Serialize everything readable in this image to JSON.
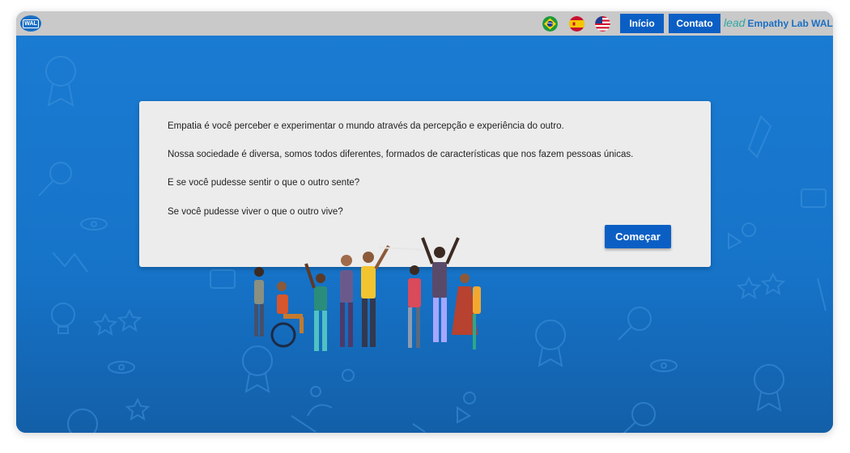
{
  "header": {
    "badge": "WAL",
    "nav": {
      "inicio": "Início",
      "contato": "Contato"
    },
    "brand": {
      "logo": "lead",
      "name": "Empathy Lab WAL"
    },
    "languages": [
      "flag-brazil",
      "flag-spain",
      "flag-usa"
    ]
  },
  "intro": {
    "line1": "Empatia é você perceber e experimentar o mundo através da percepção e experiência do outro.",
    "line2": "Nossa sociedade é diversa, somos todos diferentes, formados de características que nos fazem pessoas únicas.",
    "line3": "E se você pudesse sentir o que o outro sente?",
    "line4": "Se você pudesse viver o que o outro vive?",
    "start_label": "Começar"
  },
  "colors": {
    "accent": "#0b5fc4",
    "background": "#1673c8",
    "topbar": "#c9c9c9",
    "card": "#ececec"
  }
}
